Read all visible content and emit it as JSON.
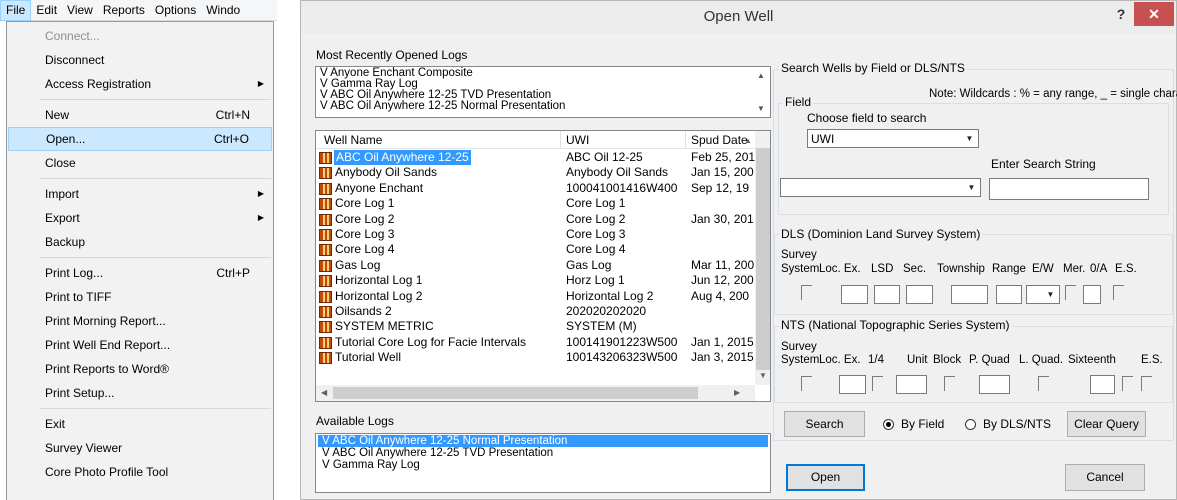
{
  "menubar": {
    "items": [
      "File",
      "Edit",
      "View",
      "Reports",
      "Options",
      "Windo"
    ]
  },
  "file_menu": {
    "connect": "Connect...",
    "disconnect": "Disconnect",
    "access_registration": "Access Registration",
    "new": "New",
    "new_sc": "Ctrl+N",
    "open": "Open...",
    "open_sc": "Ctrl+O",
    "close": "Close",
    "import": "Import",
    "export": "Export",
    "backup": "Backup",
    "print_log": "Print Log...",
    "print_log_sc": "Ctrl+P",
    "print_tiff": "Print to TIFF",
    "print_morning": "Print Morning Report...",
    "print_well_end": "Print Well End Report...",
    "print_word": "Print Reports to Word®",
    "print_setup": "Print Setup...",
    "exit": "Exit",
    "survey_viewer": "Survey Viewer",
    "core_photo": "Core Photo Profile Tool"
  },
  "dialog": {
    "title": "Open Well",
    "help": "?",
    "close": "✕",
    "recent_label": "Most Recently Opened Logs",
    "recent": [
      "V  Anyone Enchant Composite",
      "V  Gamma Ray Log",
      "V  ABC Oil Anywhere 12-25 TVD Presentation",
      "V  ABC Oil Anywhere 12-25 Normal Presentation"
    ],
    "well_columns": [
      "Well Name",
      "UWI",
      "Spud Date"
    ],
    "wells": [
      {
        "name": "ABC Oil Anywhere 12-25",
        "uwi": "ABC Oil 12-25",
        "spud": "Feb 25, 201"
      },
      {
        "name": "Anybody Oil Sands",
        "uwi": "Anybody Oil Sands",
        "spud": "Jan 15, 200"
      },
      {
        "name": "Anyone Enchant",
        "uwi": "100041001416W400",
        "spud": "Sep 12, 19"
      },
      {
        "name": "Core Log 1",
        "uwi": "Core Log 1",
        "spud": ""
      },
      {
        "name": "Core Log 2",
        "uwi": "Core Log 2",
        "spud": "Jan 30, 201"
      },
      {
        "name": "Core Log 3",
        "uwi": "Core Log 3",
        "spud": ""
      },
      {
        "name": "Core Log 4",
        "uwi": "Core Log 4",
        "spud": ""
      },
      {
        "name": "Gas Log",
        "uwi": "Gas Log",
        "spud": "Mar 11, 200"
      },
      {
        "name": "Horizontal Log 1",
        "uwi": "Horz Log 1",
        "spud": "Jun 12, 200"
      },
      {
        "name": "Horizontal Log 2",
        "uwi": "Horizontal Log 2",
        "spud": "Aug 4, 200"
      },
      {
        "name": "Oilsands 2",
        "uwi": "202020202020",
        "spud": ""
      },
      {
        "name": "SYSTEM METRIC",
        "uwi": "SYSTEM (M)",
        "spud": ""
      },
      {
        "name": "Tutorial Core Log for Facie Intervals",
        "uwi": "100141901223W500",
        "spud": "Jan 1, 2015"
      },
      {
        "name": "Tutorial Well",
        "uwi": "100143206323W500",
        "spud": "Jan 3, 2015"
      }
    ],
    "available_label": "Available Logs",
    "available": [
      "V  ABC Oil Anywhere 12-25 Normal Presentation",
      "V  ABC Oil Anywhere 12-25 TVD Presentation",
      "V  Gamma Ray Log"
    ],
    "search_group": "Search Wells by Field or DLS/NTS",
    "wildcard_note": "Note: Wildcards : % = any range, _ = single character",
    "field_group": "Field",
    "choose_field": "Choose field to search",
    "field_value": "UWI",
    "enter_search": "Enter Search String",
    "search_value": "",
    "second_combo_value": "",
    "dls_group": "DLS (Dominion Land Survey System)",
    "dls_cols": [
      "Survey",
      "System",
      "Loc. Ex.",
      "LSD",
      "Sec.",
      "Township",
      "Range",
      "E/W",
      "Mer.",
      "0/A",
      "E.S."
    ],
    "nts_group": "NTS (National Topographic Series System)",
    "nts_cols": [
      "Survey",
      "System",
      "Loc. Ex.",
      "1/4",
      "Unit",
      "Block",
      "P. Quad",
      "L. Quad.",
      "Sixteenth",
      "E.S."
    ],
    "search_btn": "Search",
    "by_field": "By Field",
    "by_dls": "By DLS/NTS",
    "clear_btn": "Clear Query",
    "open_btn": "Open",
    "cancel_btn": "Cancel"
  }
}
